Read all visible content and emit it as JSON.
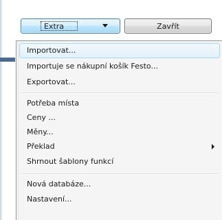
{
  "toolbar": {
    "extra_label": "Extra",
    "close_label": "Zavřít"
  },
  "menu": {
    "items": [
      {
        "label": "Importovat...",
        "highlighted": true
      },
      {
        "label": "Importuje se nákupní košík Festo..."
      },
      {
        "label": "Exportovat..."
      },
      {
        "label": "Potřeba místa"
      },
      {
        "label": "Ceny ..."
      },
      {
        "label": "Měny..."
      },
      {
        "label": "Překlad",
        "has_submenu": true
      },
      {
        "label": "Shrnout šablony funkcí"
      },
      {
        "label": "Nová databáze..."
      },
      {
        "label": "Nastavení..."
      }
    ]
  },
  "icons": {
    "dropdown_arrow": "chevron-down-icon",
    "submenu_arrow": "chevron-right-icon"
  },
  "colors": {
    "highlight_border": "#a8d8f1",
    "active_button_border": "#3c7fb1"
  }
}
